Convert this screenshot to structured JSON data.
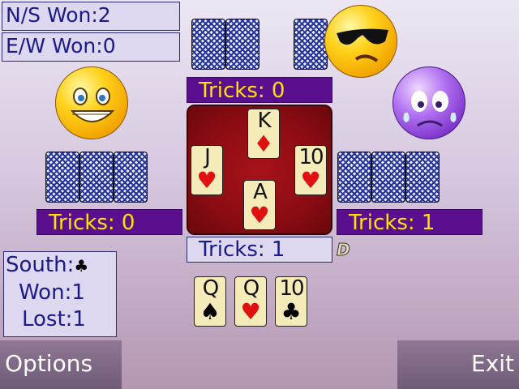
{
  "scores": {
    "ns_won": "N/S Won:2",
    "ew_won": "E/W Won:0"
  },
  "tricks": {
    "north": "Tricks:  0",
    "west": "Tricks:  0",
    "east": "Tricks:  1",
    "south": "Tricks:  1"
  },
  "dealer_marker": "D",
  "table_cards": {
    "north": {
      "rank": "K",
      "suit": "♦",
      "color": "red"
    },
    "west": {
      "rank": "J",
      "suit": "♥",
      "color": "red"
    },
    "east": {
      "rank": "10",
      "suit": "♥",
      "color": "red"
    },
    "south": {
      "rank": "A",
      "suit": "♥",
      "color": "red"
    }
  },
  "hand": [
    {
      "rank": "Q",
      "suit": "♠",
      "color": "black"
    },
    {
      "rank": "Q",
      "suit": "♥",
      "color": "red"
    },
    {
      "rank": "10",
      "suit": "♣",
      "color": "black"
    }
  ],
  "status": {
    "south_label": "South:",
    "trump_suit": "♣",
    "won": "Won:1",
    "lost": "Lost:1"
  },
  "players": {
    "north_icon": "cool-sunglasses-smiley-icon",
    "west_icon": "grinning-smiley-icon",
    "east_icon": "crying-purple-smiley-icon"
  },
  "colors": {
    "tricks_banner": "#5a0f8e",
    "tricks_text": "#ffe200",
    "table_felt": "#8a0c12",
    "panel_bg": "#ddd8f0"
  },
  "softkeys": {
    "left": "Options",
    "right": "Exit"
  }
}
